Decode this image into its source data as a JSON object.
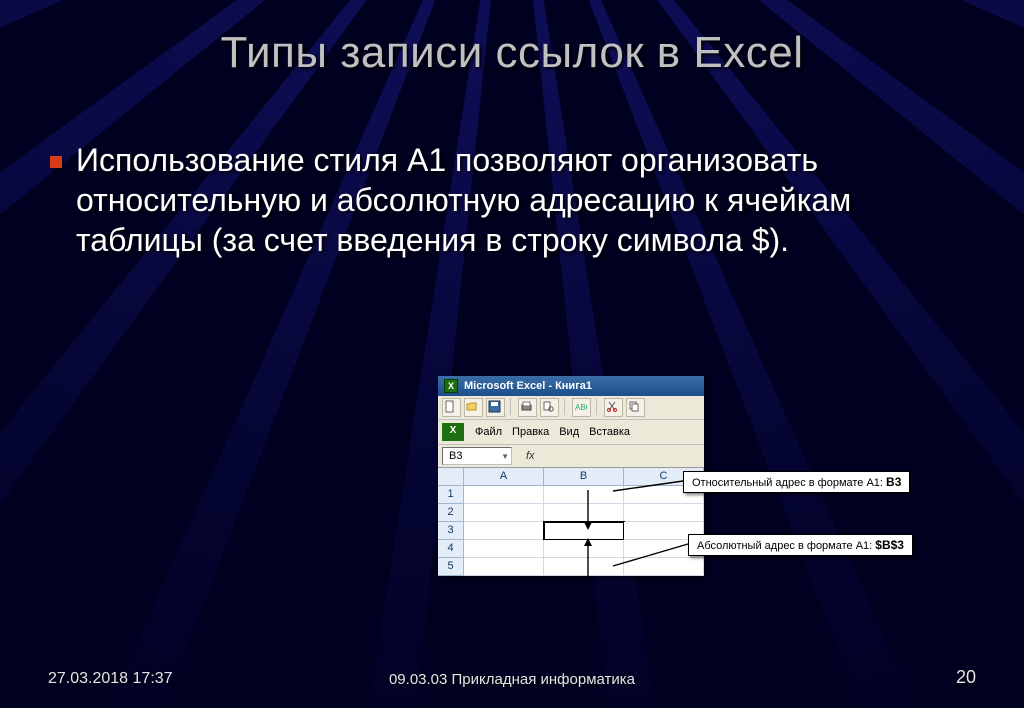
{
  "title": "Типы записи ссылок в Excel",
  "bullet": "Использование стиля А1 позволяют организовать относительную и абсолютную адресацию к ячейкам таблицы (за счет введения в строку символа $).",
  "footer": {
    "left": "27.03.2018 17:37",
    "center": "09.03.03 Прикладная информатика",
    "right": "20"
  },
  "excel": {
    "window_title": "Microsoft Excel - Книга1",
    "menu": [
      "Файл",
      "Правка",
      "Вид",
      "Вставка"
    ],
    "namebox_value": "B3",
    "fx_label": "fx",
    "columns": [
      "A",
      "B",
      "C"
    ],
    "rows": [
      "1",
      "2",
      "3",
      "4",
      "5"
    ],
    "selected_cell": "B3"
  },
  "callouts": {
    "relative": {
      "label_prefix": "Относительный адрес в формате А1:",
      "value": "B3"
    },
    "absolute": {
      "label_prefix": "Абсолютный адрес в формате А1:",
      "value": "$B$3"
    }
  }
}
